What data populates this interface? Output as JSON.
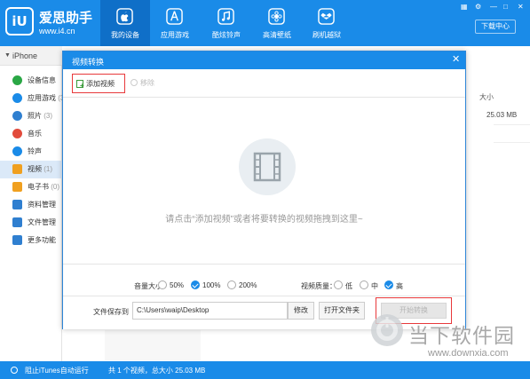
{
  "app": {
    "brand_name": "爱思助手",
    "brand_url": "www.i4.cn",
    "nav": [
      {
        "label": "我的设备",
        "icon": "apple-icon"
      },
      {
        "label": "应用游戏",
        "icon": "app-store-icon"
      },
      {
        "label": "酷炫铃声",
        "icon": "music-note-icon"
      },
      {
        "label": "高清壁纸",
        "icon": "flower-icon"
      },
      {
        "label": "刷机越狱",
        "icon": "dropbox-icon"
      }
    ],
    "download_center": "下载中心"
  },
  "sidebar": {
    "device": "iPhone",
    "items": [
      {
        "label": "设备信息",
        "count": "",
        "color": "#2aa745"
      },
      {
        "label": "应用游戏",
        "count": "(3)",
        "color": "#1a8be8"
      },
      {
        "label": "照片",
        "count": "(3)",
        "color": "#2f7fd0"
      },
      {
        "label": "音乐",
        "count": "",
        "color": "#e24b3c"
      },
      {
        "label": "铃声",
        "count": "",
        "color": "#1a8be8"
      },
      {
        "label": "视频",
        "count": "(1)",
        "color": "#f0a020"
      },
      {
        "label": "电子书",
        "count": "(0)",
        "color": "#f0a020"
      },
      {
        "label": "资料管理",
        "count": "",
        "color": "#2f7fd0"
      },
      {
        "label": "文件管理",
        "count": "",
        "color": "#2f7fd0"
      },
      {
        "label": "更多功能",
        "count": "",
        "color": "#2f7fd0"
      }
    ]
  },
  "background": {
    "size_header": "大小",
    "size_value": "25.03 MB"
  },
  "dialog": {
    "title": "视频转换",
    "add_video": "添加视频",
    "remove": "移除",
    "hint": "请点击“添加视频”或者将要转换的视频拖拽到这里~",
    "volume_label": "音量大小：",
    "volume_options": [
      "50%",
      "100%",
      "200%"
    ],
    "volume_selected": "100%",
    "quality_label": "视频质量：",
    "quality_options": [
      "低",
      "中",
      "高"
    ],
    "quality_selected": "高",
    "save_path_label": "文件保存到",
    "save_path": "C:\\Users\\waip\\Desktop",
    "modify": "修改",
    "open_folder": "打开文件夹",
    "start": "开始转换"
  },
  "status": {
    "itunes": "阻止iTunes自动运行",
    "summary": "共 1 个视频，总大小 25.03 MB"
  },
  "watermark": {
    "text": "当下软件园",
    "url": "www.downxia.com"
  }
}
